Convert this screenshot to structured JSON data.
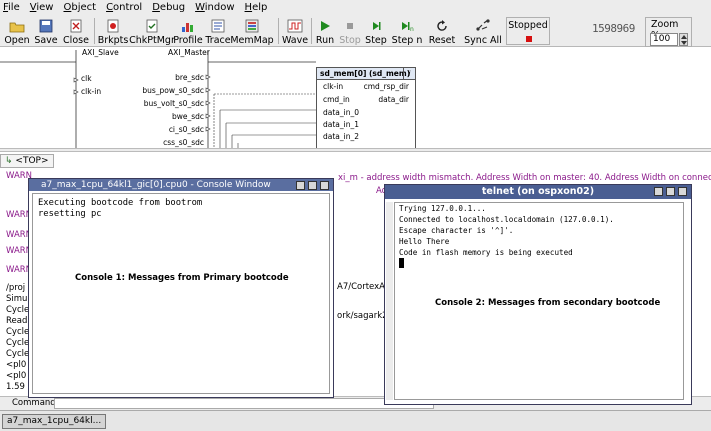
{
  "menu": [
    "File",
    "View",
    "Object",
    "Control",
    "Debug",
    "Window",
    "Help"
  ],
  "toolbar": {
    "open": "Open",
    "save": "Save",
    "close": "Close",
    "brkpts": "Brkpts",
    "chkptmgr": "ChkPtMgr",
    "profile": "Profile",
    "trace": "Trace",
    "memmap": "MemMap",
    "wave": "Wave",
    "run": "Run",
    "stop": "Stop",
    "step": "Step",
    "stepn": "Step n",
    "reset": "Reset",
    "syncall": "Sync All",
    "status": "Stopped",
    "counter": "1598969",
    "zoom_label": "Zoom %:",
    "zoom_value": "100"
  },
  "schematic": {
    "axi_slave": "AXI_Slave",
    "axi_master": "AXI_Master",
    "clk": "clk",
    "clkin": "clk-in",
    "left_ports": [
      "bre_sdc",
      "bus_pow_s0_sdc",
      "bus_volt_s0_sdc",
      "bwe_sdc",
      "ci_s0_sdc",
      "css_s0_sdc"
    ],
    "sd_title": "sd_mem[0] (sd_mem)",
    "sd_info": "i",
    "sd_in_ports": [
      "clk-in",
      "cmd_in",
      "data_in_0",
      "data_in_1",
      "data_in_2"
    ],
    "sd_out_ports": [
      "cmd_rsp_dir",
      "data_dir"
    ]
  },
  "top_tab": "<TOP>",
  "log": {
    "warn_line1_right": "xi_m - address width mismatch. Address Width on master: 40. Address Width on connected slave: 32",
    "warn_frag": "Ad",
    "left_labels": [
      "WARN",
      "WARN",
      "WARN",
      "WARN",
      "WARN",
      "WARN"
    ],
    "left_lines": [
      "/proj",
      "Simu",
      "Cycle",
      "Read",
      "Cycle",
      "Cycle",
      "Cycle",
      "<pl0",
      "<pl0",
      "1.59"
    ],
    "mid_frag1": "A7/CortexA7-",
    "mid_frag2": "ork/sagark2/"
  },
  "command": {
    "label": "Command"
  },
  "taskbar": {
    "item": "a7_max_1cpu_64kl..."
  },
  "console1": {
    "title": "a7_max_1cpu_64kl1_gic[0].cpu0 - Console Window",
    "lines": "Executing bootcode from bootrom\nresetting pc",
    "caption": "Console 1:  Messages from Primary bootcode"
  },
  "console2": {
    "title": "telnet (on ospxon02)",
    "lines": "Trying 127.0.0.1...\nConnected to localhost.localdomain (127.0.0.1).\nEscape character is '^]'.\nHello There\nCode in flash memory is being executed",
    "caption": "Console 2: Messages from secondary bootcode"
  },
  "colors": {
    "title_bar": "#5a6ea0",
    "warn": "#8b1a8b",
    "stop_indicator": "#d61010"
  }
}
